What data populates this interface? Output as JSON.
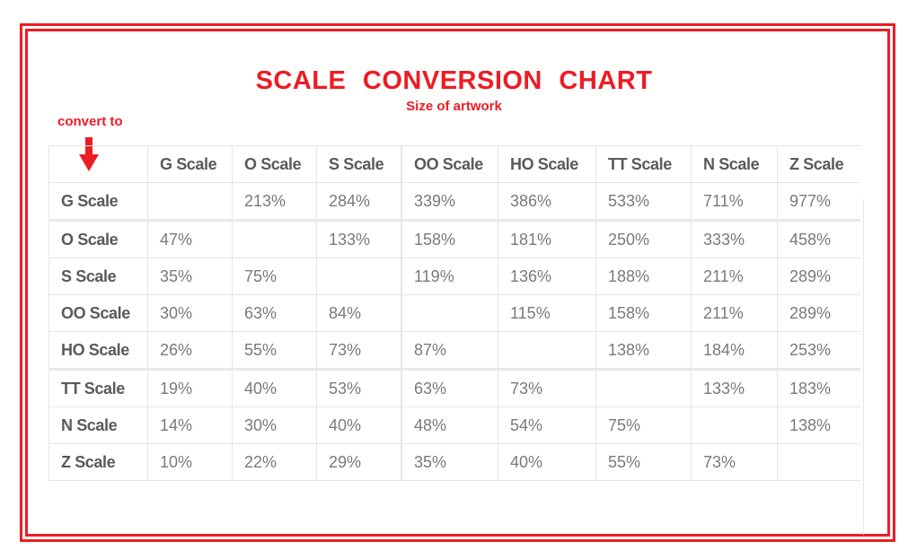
{
  "header": {
    "title": "SCALE  CONVERSION  CHART",
    "subtitle": "Size of artwork",
    "convert_label": "convert to",
    "arrow_icon": "arrow-down-icon"
  },
  "colors": {
    "accent": "#ed1c24",
    "grid": "#e6e6e6",
    "text": "#6f6f6f"
  },
  "table": {
    "columns": [
      "",
      "G Scale",
      "O Scale",
      "S Scale",
      "OO Scale",
      "HO Scale",
      "TT Scale",
      "N Scale",
      "Z Scale"
    ],
    "rows": [
      {
        "label": "G Scale",
        "values": [
          "",
          "213%",
          "284%",
          "339%",
          "386%",
          "533%",
          "711%",
          "977%"
        ]
      },
      {
        "label": "O Scale",
        "values": [
          "47%",
          "",
          "133%",
          "158%",
          "181%",
          "250%",
          "333%",
          "458%"
        ]
      },
      {
        "label": "S Scale",
        "values": [
          "35%",
          "75%",
          "",
          "119%",
          "136%",
          "188%",
          "211%",
          "289%"
        ]
      },
      {
        "label": "OO Scale",
        "values": [
          "30%",
          "63%",
          "84%",
          "",
          "115%",
          "158%",
          "211%",
          "289%"
        ]
      },
      {
        "label": "HO Scale",
        "values": [
          "26%",
          "55%",
          "73%",
          "87%",
          "",
          "138%",
          "184%",
          "253%"
        ]
      },
      {
        "label": "TT Scale",
        "values": [
          "19%",
          "40%",
          "53%",
          "63%",
          "73%",
          "",
          "133%",
          "183%"
        ]
      },
      {
        "label": "N Scale",
        "values": [
          "14%",
          "30%",
          "40%",
          "48%",
          "54%",
          "75%",
          "",
          "138%"
        ]
      },
      {
        "label": "Z Scale",
        "values": [
          "10%",
          "22%",
          "29%",
          "35%",
          "40%",
          "55%",
          "73%",
          ""
        ]
      }
    ]
  }
}
